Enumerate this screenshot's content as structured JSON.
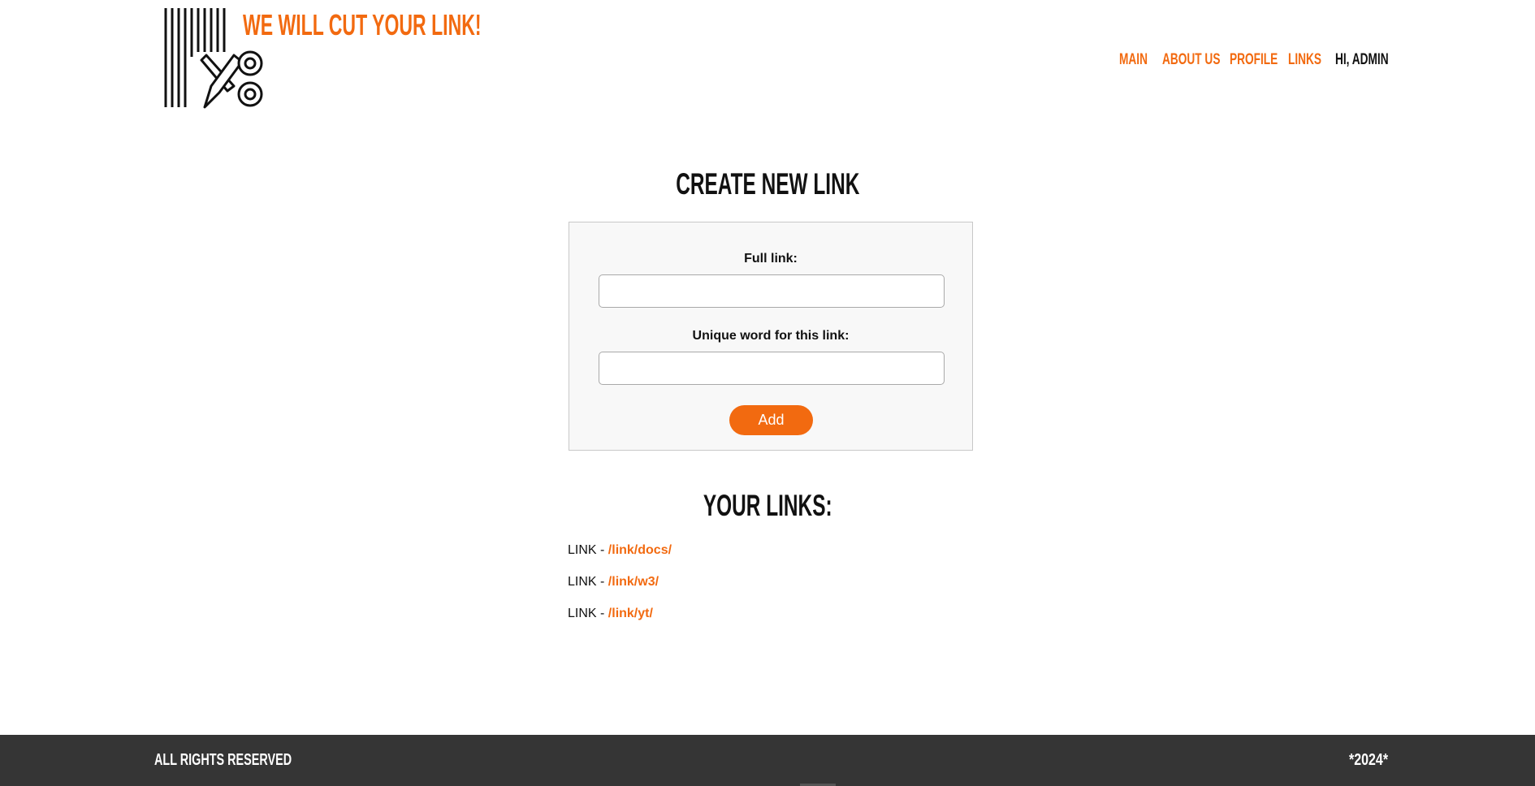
{
  "header": {
    "site_title": "WE WILL CUT YOUR LINK!",
    "logo_icon": "scissors-cutting-lines-icon",
    "nav": {
      "main": "MAIN",
      "about": "ABOUT US",
      "profile": "PROFILE",
      "links": "LINKS",
      "greeting": "HI, ADMIN"
    }
  },
  "create_section": {
    "title": "CREATE NEW LINK",
    "full_link_label": "Full link:",
    "full_link_value": "",
    "unique_word_label": "Unique word for this link:",
    "unique_word_value": "",
    "add_button": "Add"
  },
  "links_section": {
    "title": "YOUR LINKS:",
    "items": [
      {
        "prefix": "LINK - ",
        "href": "/link/docs/"
      },
      {
        "prefix": "LINK - ",
        "href": "/link/w3/"
      },
      {
        "prefix": "LINK - ",
        "href": "/link/yt/"
      }
    ]
  },
  "footer": {
    "left": "ALL RIGHTS RESERVED",
    "right": "*2024*"
  },
  "colors": {
    "accent": "#f26a10",
    "footer_bg": "#353535",
    "form_bg": "#f8f8f8",
    "text": "#111111"
  }
}
